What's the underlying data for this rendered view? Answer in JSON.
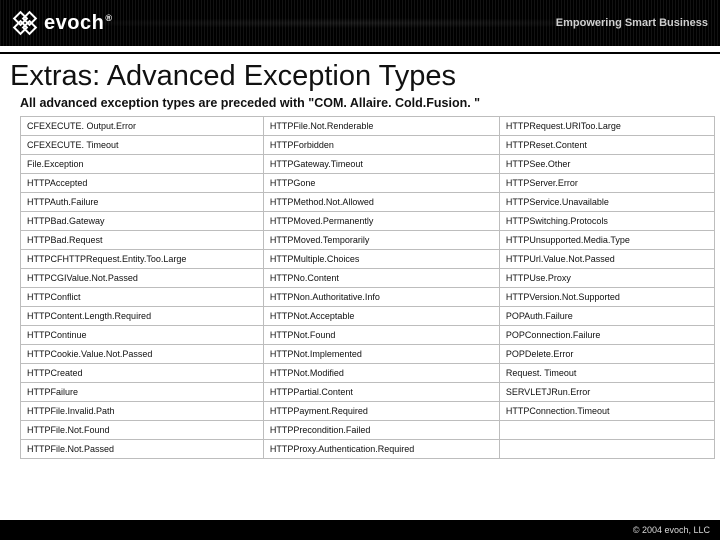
{
  "brand": {
    "name": "evoch",
    "reg": "®",
    "tagline": "Empowering Smart Business"
  },
  "page": {
    "title": "Extras: Advanced Exception Types",
    "subtitle": "All advanced exception types are preceded with \"COM. Allaire. Cold.Fusion. \""
  },
  "table": {
    "rows": [
      [
        "CFEXECUTE. Output.Error",
        "HTTPFile.Not.Renderable",
        "HTTPRequest.URIToo.Large"
      ],
      [
        "CFEXECUTE. Timeout",
        "HTTPForbidden",
        "HTTPReset.Content"
      ],
      [
        "File.Exception",
        "HTTPGateway.Timeout",
        "HTTPSee.Other"
      ],
      [
        "HTTPAccepted",
        "HTTPGone",
        "HTTPServer.Error"
      ],
      [
        "HTTPAuth.Failure",
        "HTTPMethod.Not.Allowed",
        "HTTPService.Unavailable"
      ],
      [
        "HTTPBad.Gateway",
        "HTTPMoved.Permanently",
        "HTTPSwitching.Protocols"
      ],
      [
        "HTTPBad.Request",
        "HTTPMoved.Temporarily",
        "HTTPUnsupported.Media.Type"
      ],
      [
        "HTTPCFHTTPRequest.Entity.Too.Large",
        "HTTPMultiple.Choices",
        "HTTPUrl.Value.Not.Passed"
      ],
      [
        "HTTPCGIValue.Not.Passed",
        "HTTPNo.Content",
        "HTTPUse.Proxy"
      ],
      [
        "HTTPConflict",
        "HTTPNon.Authoritative.Info",
        "HTTPVersion.Not.Supported"
      ],
      [
        "HTTPContent.Length.Required",
        "HTTPNot.Acceptable",
        "POPAuth.Failure"
      ],
      [
        "HTTPContinue",
        "HTTPNot.Found",
        "POPConnection.Failure"
      ],
      [
        "HTTPCookie.Value.Not.Passed",
        "HTTPNot.Implemented",
        "POPDelete.Error"
      ],
      [
        "HTTPCreated",
        "HTTPNot.Modified",
        "Request. Timeout"
      ],
      [
        "HTTPFailure",
        "HTTPPartial.Content",
        "SERVLETJRun.Error"
      ],
      [
        "HTTPFile.Invalid.Path",
        "HTTPPayment.Required",
        "HTTPConnection.Timeout"
      ],
      [
        "HTTPFile.Not.Found",
        "HTTPPrecondition.Failed",
        ""
      ],
      [
        "HTTPFile.Not.Passed",
        "HTTPProxy.Authentication.Required",
        ""
      ]
    ]
  },
  "footer": {
    "copyright": "© 2004 evoch, LLC"
  }
}
